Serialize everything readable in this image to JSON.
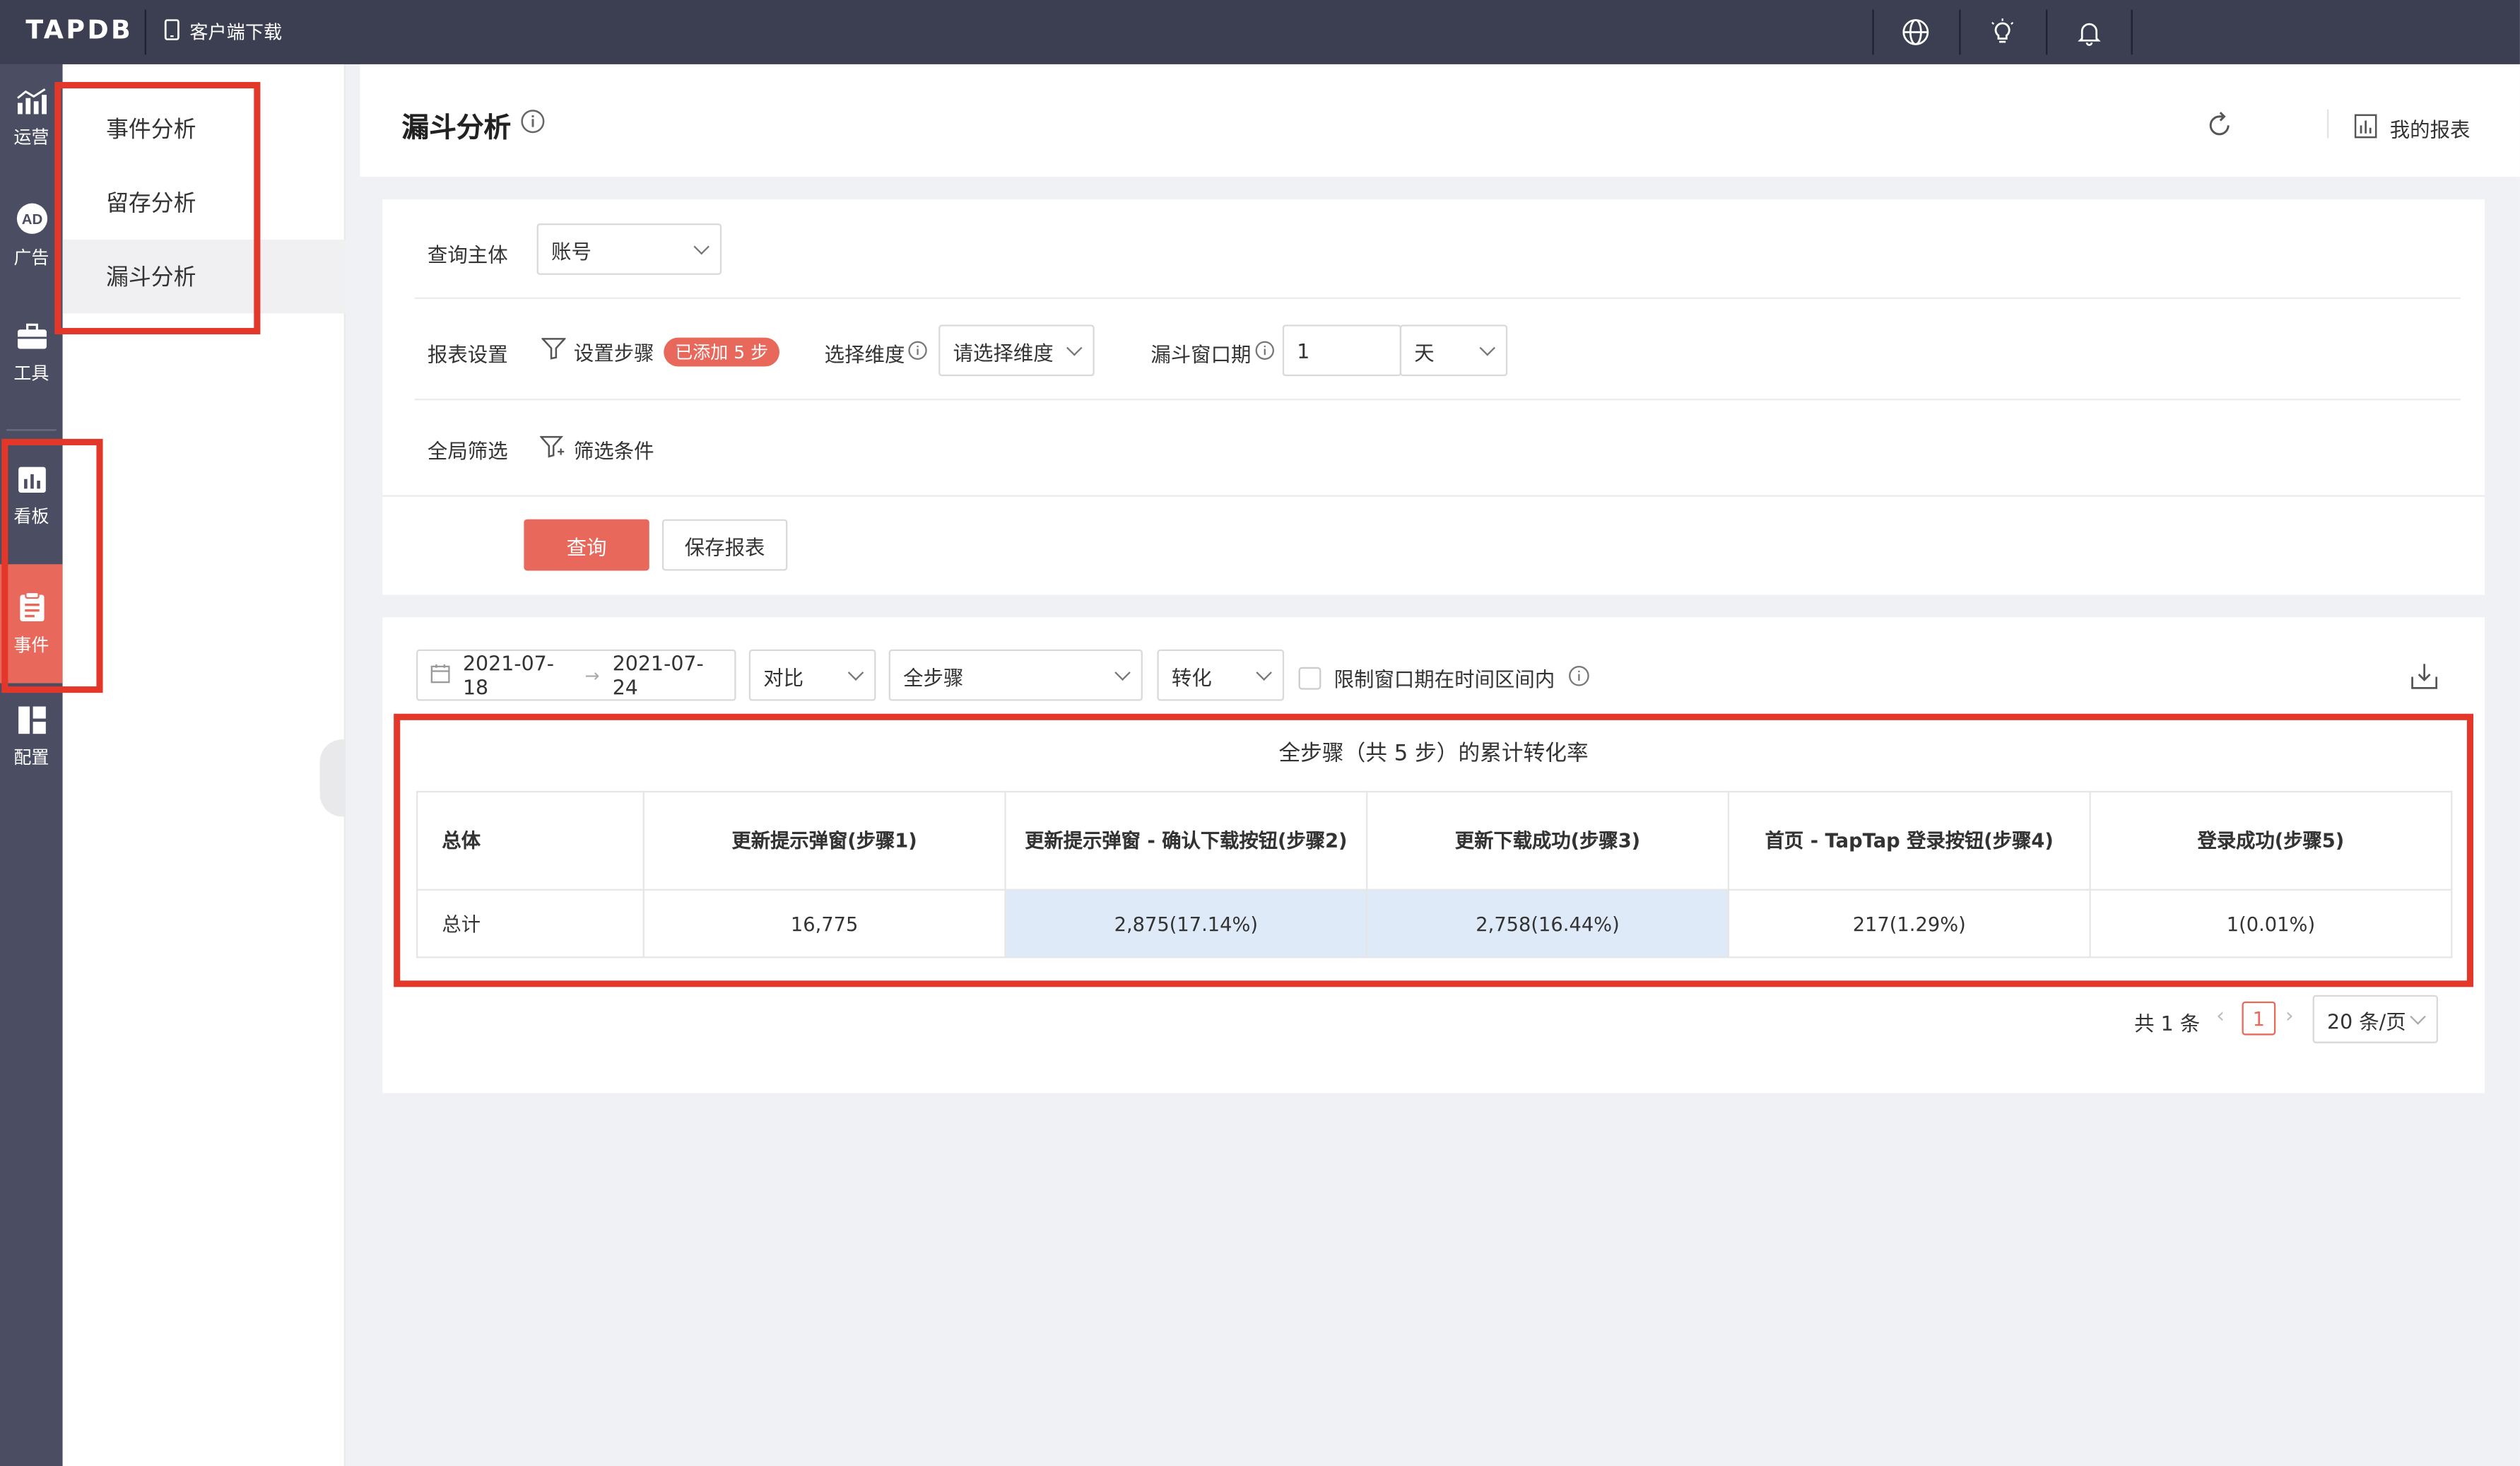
{
  "topbar": {
    "logo": "TAPDB",
    "client_download": "客户端下载",
    "icons": [
      "phone-icon",
      "globe-icon",
      "lightbulb-icon",
      "bell-icon"
    ]
  },
  "rail": {
    "items": [
      {
        "label": "运营",
        "icon": "chart-icon"
      },
      {
        "label": "广告",
        "icon": "ad-icon"
      },
      {
        "label": "工具",
        "icon": "toolbox-icon"
      },
      {
        "label": "看板",
        "icon": "dashboard-icon"
      },
      {
        "label": "事件",
        "icon": "clipboard-icon",
        "active": true
      },
      {
        "label": "配置",
        "icon": "layout-icon"
      }
    ]
  },
  "submenu": {
    "items": [
      "事件分析",
      "留存分析",
      "漏斗分析"
    ],
    "active": "漏斗分析"
  },
  "header": {
    "title": "漏斗分析",
    "my_reports": "我的报表"
  },
  "query": {
    "subject_label": "查询主体",
    "subject_value": "账号",
    "report_settings_label": "报表设置",
    "set_steps": "设置步骤",
    "steps_badge": "已添加 5 步",
    "dimension_label": "选择维度",
    "dimension_placeholder": "请选择维度",
    "window_label": "漏斗窗口期",
    "window_value": "1",
    "window_unit": "天",
    "global_filter_label": "全局筛选",
    "filter_conditions": "筛选条件",
    "query_button": "查询",
    "save_button": "保存报表"
  },
  "result": {
    "date_start": "2021-07-18",
    "date_end": "2021-07-24",
    "compare": "对比",
    "steps_select": "全步骤",
    "metric_select": "转化",
    "limit_window": "限制窗口期在时间区间内",
    "table_title": "全步骤（共 5 步）的累计转化率",
    "columns": [
      "总体",
      "更新提示弹窗(步骤1)",
      "更新提示弹窗 - 确认下载按钮(步骤2)",
      "更新下载成功(步骤3)",
      "首页 - TapTap 登录按钮(步骤4)",
      "登录成功(步骤5)"
    ],
    "rows": [
      [
        "总计",
        "16,775",
        "2,875(17.14%)",
        "2,758(16.44%)",
        "217(1.29%)",
        "1(0.01%)"
      ]
    ],
    "pagination": {
      "total": "共 1 条",
      "page": "1",
      "page_size": "20 条/页"
    }
  },
  "colors": {
    "accent": "#e8695c",
    "topbar": "#3c3f51",
    "rail": "#4b4d63",
    "annotation": "#e3372a",
    "highlight": "#dfeaf8"
  }
}
